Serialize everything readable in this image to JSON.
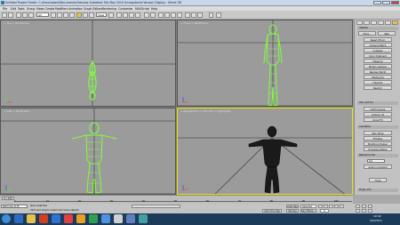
{
  "window": {
    "title": "Untitled    Project Folder: C:\\Users\\abeel\\Documents\\3dsmax    Autodesk 3ds Max 2010    Unregistered Version    Display : Direct 3D"
  },
  "menu": {
    "items": [
      "File",
      "Edit",
      "Tools",
      "Group",
      "Views",
      "Create",
      "Modifiers",
      "Animation",
      "Graph Editors",
      "Rendering",
      "Customize",
      "MAXScript",
      "Help"
    ]
  },
  "toolbar": {
    "selection_filter": "All",
    "view_dropdown": "View"
  },
  "viewports": [
    {
      "label": "+ Top + Wireframe"
    },
    {
      "label": "+ Front + Wireframe"
    },
    {
      "label": "+ Left + Wireframe"
    },
    {
      "label": "+ Perspective + Smooth + Highlights"
    }
  ],
  "command_panel": {
    "tabs": [
      "Utilities"
    ],
    "buttons": [
      "More...",
      "Sets",
      "Reset XForm",
      "Camera Match",
      "Collapse",
      "Color Clipboard",
      "Measure",
      "Motion Capture",
      "Rescale World",
      "MAXScript",
      "Flash FX",
      "Reactor"
    ],
    "section_hair": "Hair and Fur",
    "btns2": [
      "UVW Unwrap",
      "Collision St",
      "Ghost FX"
    ],
    "section_anim": "Animation",
    "btns3": [
      "Skin Wrap",
      "FFD Box",
      "Modifying Helper",
      "Envelope Helper"
    ],
    "section_ref": "Reference Tex",
    "ref_value": "0.0",
    "apply_btn": "Apply Increment",
    "close_btn": "Close",
    "section_plugin": "Plugin Info"
  },
  "timeline": {
    "position": "0 / 100",
    "ticks": [
      "0",
      "10",
      "20",
      "30",
      "40",
      "50",
      "60",
      "70",
      "80",
      "90",
      "100"
    ]
  },
  "status": {
    "selection": "None Selected",
    "prompt": "Click and drag to select and move objects",
    "welcome": "Welcome to M",
    "add_time_tag": "Add Time Tag",
    "auto_key": "Auto Key",
    "selected": "Selected",
    "set_key": "Set Key",
    "key_filters": "Key Filters...",
    "frame": "0"
  },
  "taskbar": {
    "time": "10:42",
    "date": "4/5/2013"
  },
  "colors": {
    "active_border": "#e8e000",
    "wire": "#7fff3a"
  }
}
